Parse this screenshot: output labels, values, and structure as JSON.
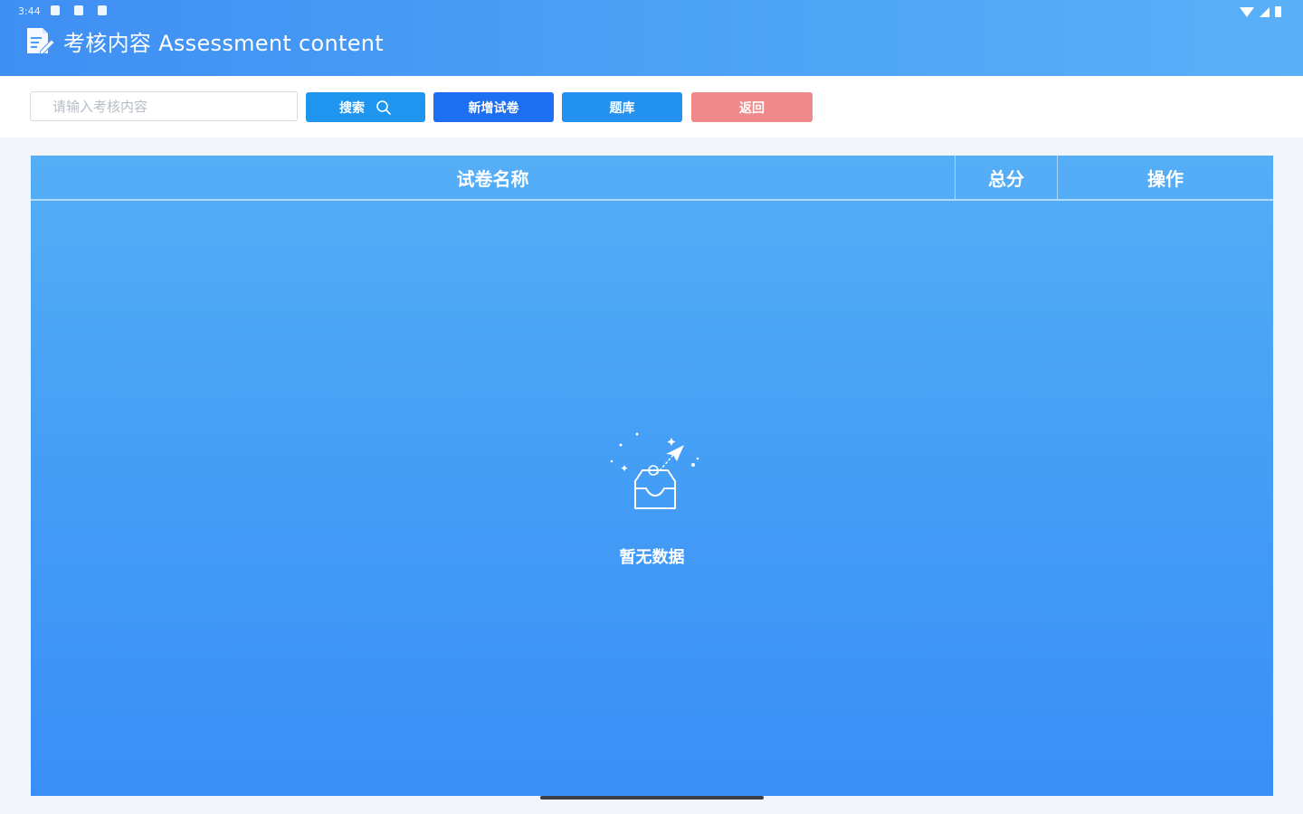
{
  "status_bar": {
    "time": "3:44"
  },
  "header": {
    "title": "考核内容 Assessment content"
  },
  "toolbar": {
    "search_placeholder": "请输入考核内容",
    "search_value": "",
    "search_label": "搜索",
    "add_paper_label": "新增试卷",
    "question_bank_label": "题库",
    "back_label": "返回"
  },
  "table": {
    "columns": [
      "试卷名称",
      "总分",
      "操作"
    ],
    "rows": [],
    "empty_text": "暂无数据"
  },
  "colors": {
    "header_gradient": [
      "#3f8ff3",
      "#5ab0f7"
    ],
    "search_button": "#1e96f0",
    "add_button": "#1b6ff0",
    "bank_button": "#2391f0",
    "back_button": "#f08a8a",
    "panel": "#459ff6"
  }
}
